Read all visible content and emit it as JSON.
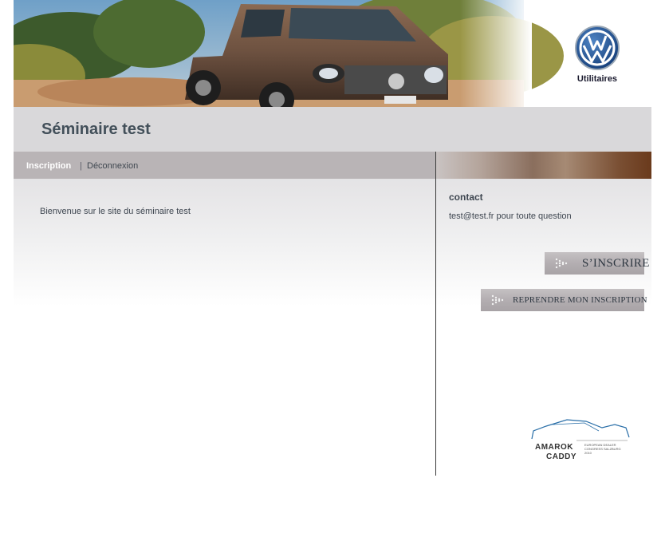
{
  "banner": {
    "brand_label": "Utilitaires",
    "accent_color": "#1c4f8f"
  },
  "header": {
    "title": "Séminaire test"
  },
  "nav": {
    "inscription": "Inscription",
    "separator": "|",
    "deconnexion": "Déconnexion"
  },
  "main": {
    "welcome_text": "Bienvenue sur le site du séminaire test"
  },
  "sidebar": {
    "contact_title": "contact",
    "contact_text": "test@test.fr pour toute question",
    "buttons": {
      "inscrire": "S’inscrire",
      "reprendre": "Reprendre mon inscription"
    }
  },
  "event_logo": {
    "line1": "AMAROK",
    "line2": "CADDY",
    "tagline": "EUROPEAN DEALER CONGRESS SALZBURG 2010"
  },
  "icons": {
    "vw_logo": "vw-logo-icon",
    "button_arrow": "dotted-arrow-icon"
  }
}
